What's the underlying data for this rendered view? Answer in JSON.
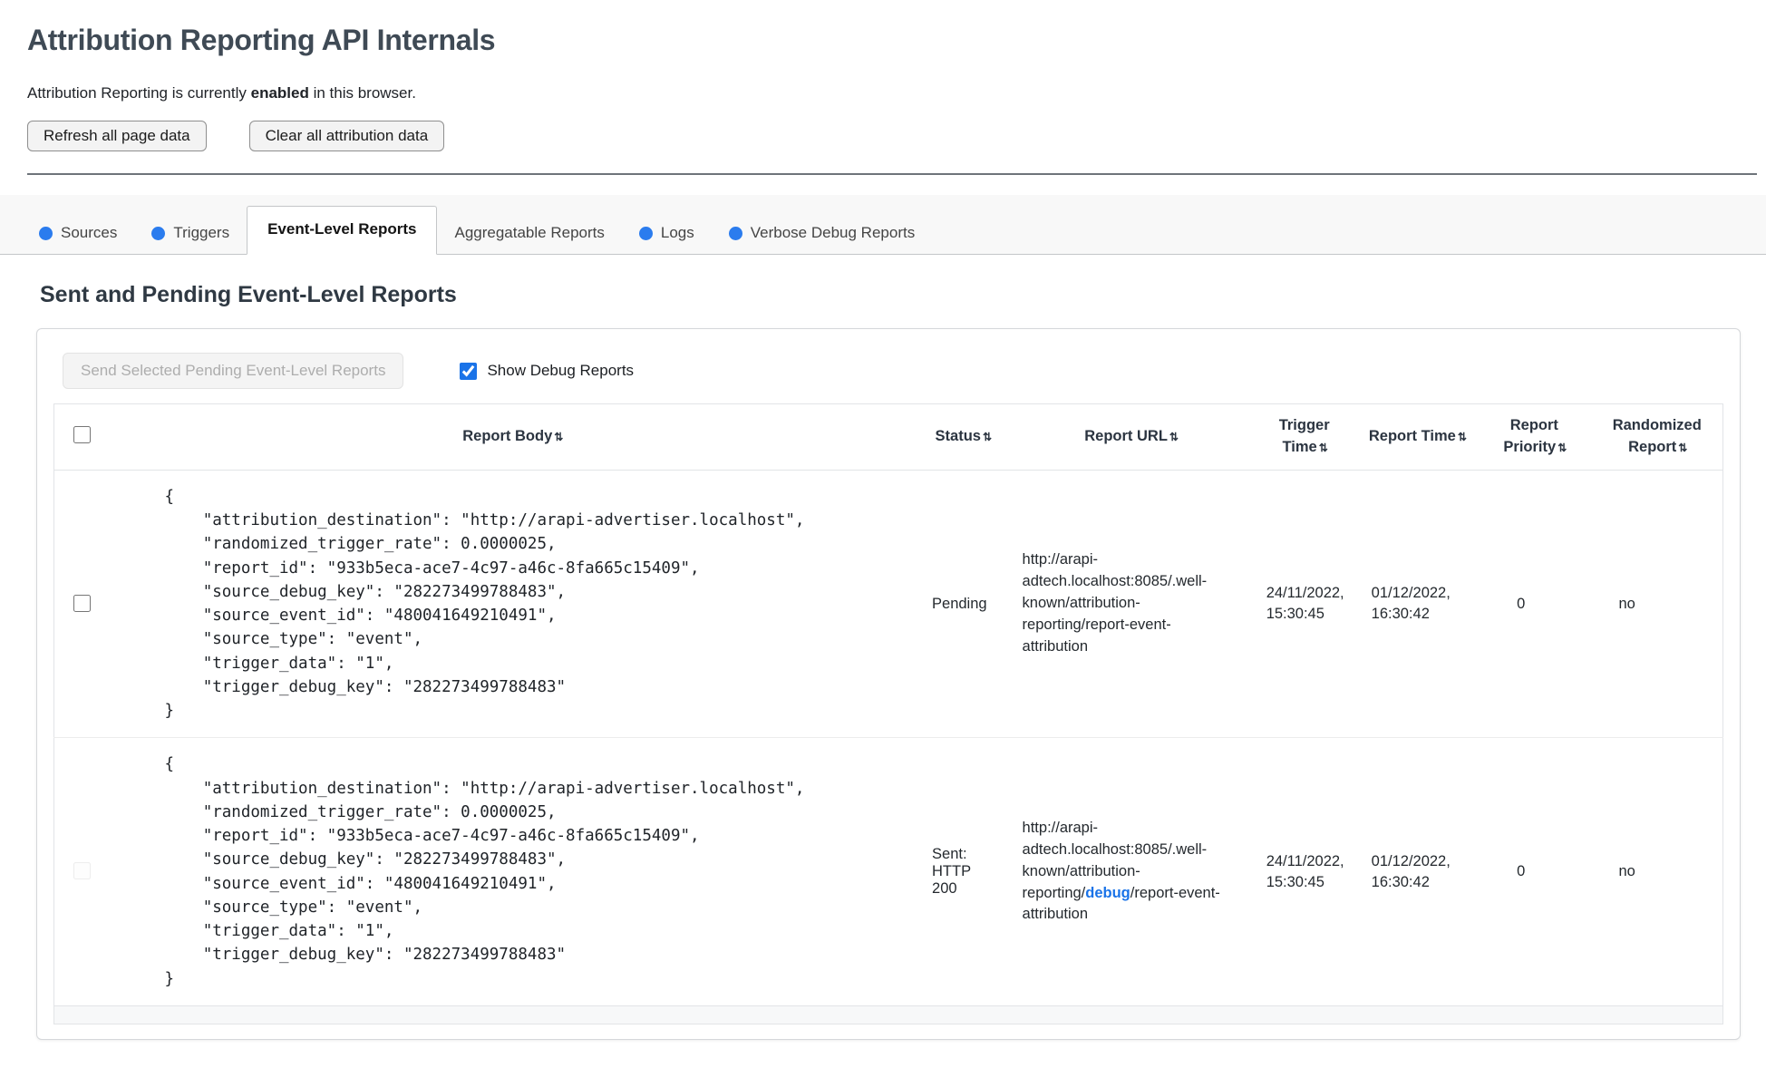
{
  "page": {
    "title": "Attribution Reporting API Internals",
    "status_prefix": "Attribution Reporting is currently ",
    "status_bold": "enabled",
    "status_suffix": " in this browser.",
    "refresh_button": "Refresh all page data",
    "clear_button": "Clear all attribution data"
  },
  "tabs": [
    {
      "label": "Sources",
      "dot": true,
      "active": false
    },
    {
      "label": "Triggers",
      "dot": true,
      "active": false
    },
    {
      "label": "Event-Level Reports",
      "dot": false,
      "active": true
    },
    {
      "label": "Aggregatable Reports",
      "dot": false,
      "active": false
    },
    {
      "label": "Logs",
      "dot": true,
      "active": false
    },
    {
      "label": "Verbose Debug Reports",
      "dot": true,
      "active": false
    }
  ],
  "panel": {
    "heading": "Sent and Pending Event-Level Reports",
    "send_button": "Send Selected Pending Event-Level Reports",
    "send_button_enabled": false,
    "show_debug_label": "Show Debug Reports",
    "show_debug_checked": true
  },
  "table": {
    "sort_icon": "⇅",
    "headers": [
      "Report Body",
      "Status",
      "Report URL",
      "Trigger Time",
      "Report Time",
      "Report Priority",
      "Randomized Report"
    ],
    "rows": [
      {
        "selected": false,
        "selectable": true,
        "report_body": "{\n    \"attribution_destination\": \"http://arapi-advertiser.localhost\",\n    \"randomized_trigger_rate\": 0.0000025,\n    \"report_id\": \"933b5eca-ace7-4c97-a46c-8fa665c15409\",\n    \"source_debug_key\": \"282273499788483\",\n    \"source_event_id\": \"480041649210491\",\n    \"source_type\": \"event\",\n    \"trigger_data\": \"1\",\n    \"trigger_debug_key\": \"282273499788483\"\n}",
        "status": "Pending",
        "report_url": "http://arapi-adtech.localhost:8085/.well-known/attribution-reporting/report-event-attribution",
        "trigger_time": "24/11/2022, 15:30:45",
        "report_time": "01/12/2022, 16:30:42",
        "report_priority": "0",
        "randomized_report": "no"
      },
      {
        "selected": false,
        "selectable": false,
        "report_body": "{\n    \"attribution_destination\": \"http://arapi-advertiser.localhost\",\n    \"randomized_trigger_rate\": 0.0000025,\n    \"report_id\": \"933b5eca-ace7-4c97-a46c-8fa665c15409\",\n    \"source_debug_key\": \"282273499788483\",\n    \"source_event_id\": \"480041649210491\",\n    \"source_type\": \"event\",\n    \"trigger_data\": \"1\",\n    \"trigger_debug_key\": \"282273499788483\"\n}",
        "status": "Sent: HTTP 200",
        "report_url_prefix": "http://arapi-adtech.localhost:8085/.well-known/attribution-reporting/",
        "report_url_link": "debug",
        "report_url_suffix": "/report-event-attribution",
        "trigger_time": "24/11/2022, 15:30:45",
        "report_time": "01/12/2022, 16:30:42",
        "report_priority": "0",
        "randomized_report": "no"
      }
    ]
  },
  "colors": {
    "tab_dot_blue": "#2b7cee",
    "link_blue": "#1a73e8",
    "checkbox_accent": "#1a73e8",
    "heading_slate": "#3f4a55"
  }
}
